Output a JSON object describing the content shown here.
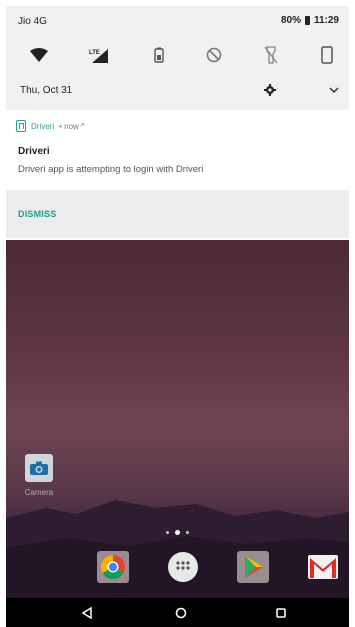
{
  "status_bar": {
    "carrier": "Jio 4G",
    "battery": "80%",
    "time": "11:29"
  },
  "quick_settings": {
    "icons": [
      "wifi-icon",
      "signal-lte-icon",
      "battery-saver-icon",
      "do-not-disturb-off-icon",
      "flashlight-off-icon",
      "auto-rotate-icon"
    ],
    "date": "Thu, Oct 31"
  },
  "notification": {
    "app_name": "Driveri",
    "meta": " • now ^",
    "title": "Driveri",
    "body": "Driveri app is attempting to login with Driveri",
    "action": "DISMISS",
    "accent": "#27a393"
  },
  "home": {
    "camera_label": "Camera",
    "dock": [
      "chrome-icon",
      "app-drawer-icon",
      "play-store-icon",
      "gmail-icon"
    ]
  },
  "nav": [
    "back-icon",
    "home-icon",
    "recents-icon"
  ]
}
